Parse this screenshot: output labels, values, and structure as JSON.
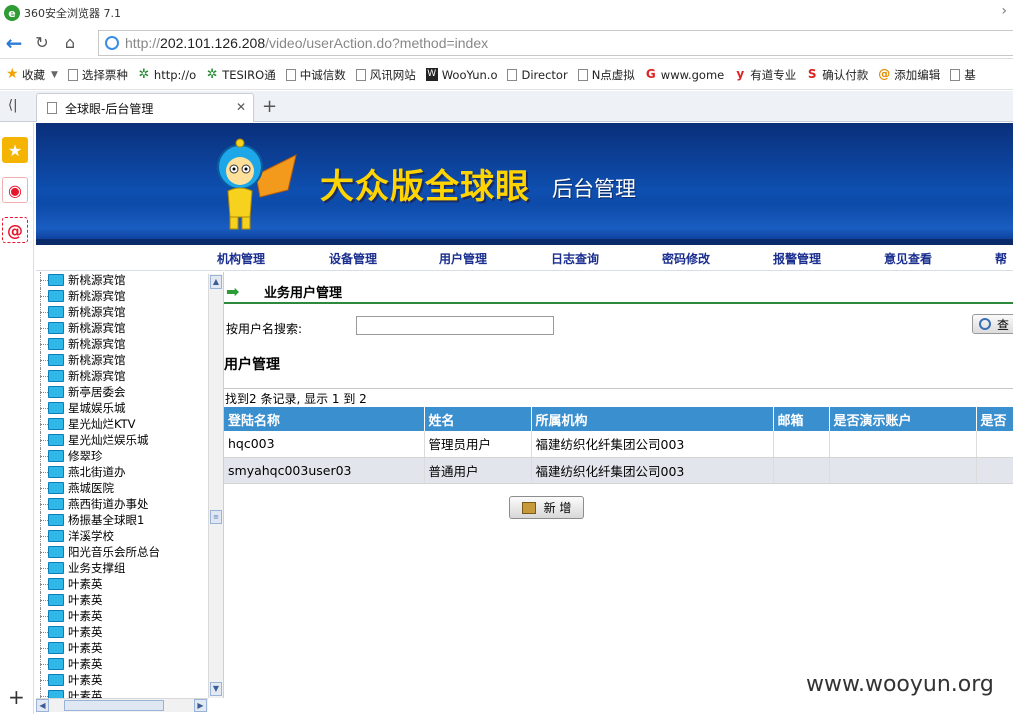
{
  "browser": {
    "title": "360安全浏览器 7.1",
    "url_prefix": "http://",
    "url_host": "202.101.126.208",
    "url_path": "/video/userAction.do?method=index"
  },
  "bookmarks": [
    {
      "label": "收藏",
      "icon": "star-icon"
    },
    {
      "label": "选择票种",
      "icon": "page-icon"
    },
    {
      "label": "http://o",
      "icon": "gear-green-icon"
    },
    {
      "label": "TESIRO通",
      "icon": "gear-green-icon"
    },
    {
      "label": "中诚信数",
      "icon": "page-icon"
    },
    {
      "label": "风讯网站",
      "icon": "page-icon"
    },
    {
      "label": "WooYun.o",
      "icon": "wooyun-icon"
    },
    {
      "label": "Director",
      "icon": "page-icon"
    },
    {
      "label": "N点虚拟",
      "icon": "page-icon"
    },
    {
      "label": "www.gome",
      "icon": "gome-icon"
    },
    {
      "label": "有道专业",
      "icon": "youdao-icon"
    },
    {
      "label": "确认付款",
      "icon": "s-icon"
    },
    {
      "label": "添加编辑",
      "icon": "swirl-icon"
    },
    {
      "label": "基",
      "icon": "page-icon"
    }
  ],
  "tab": {
    "label": "全球眼-后台管理"
  },
  "banner": {
    "title": "大众版全球眼",
    "subtitle": "后台管理"
  },
  "menu": [
    "机构管理",
    "设备管理",
    "用户管理",
    "日志查询",
    "密码修改",
    "报警管理",
    "意见查看",
    "帮"
  ],
  "tree": [
    "新桃源宾馆",
    "新桃源宾馆",
    "新桃源宾馆",
    "新桃源宾馆",
    "新桃源宾馆",
    "新桃源宾馆",
    "新桃源宾馆",
    "新亭居委会",
    "星城娱乐城",
    "星光灿烂KTV",
    "星光灿烂娱乐城",
    "修翠珍",
    "燕北街道办",
    "燕城医院",
    "燕西街道办事处",
    "杨振基全球眼1",
    "洋溪学校",
    "阳光音乐会所总台",
    "业务支撑组",
    "叶素英",
    "叶素英",
    "叶素英",
    "叶素英",
    "叶素英",
    "叶素英",
    "叶素英",
    "叶素英"
  ],
  "main": {
    "section_title": "业务用户管理",
    "search_label": "按用户名搜索:",
    "search_value": "",
    "query_label": "查",
    "list_title": "用户管理",
    "record_summary": "找到2 条记录, 显示 1 到 2",
    "columns": [
      "登陆名称",
      "姓名",
      "所属机构",
      "邮箱",
      "是否演示账户",
      "是否"
    ],
    "rows": [
      [
        "hqc003",
        "管理员用户",
        "福建纺织化纤集团公司003",
        "",
        "",
        ""
      ],
      [
        "smyahqc003user03",
        "普通用户",
        "福建纺织化纤集团公司003",
        "",
        "",
        ""
      ]
    ],
    "add_label": "新 增"
  },
  "watermark": "www.wooyun.org"
}
